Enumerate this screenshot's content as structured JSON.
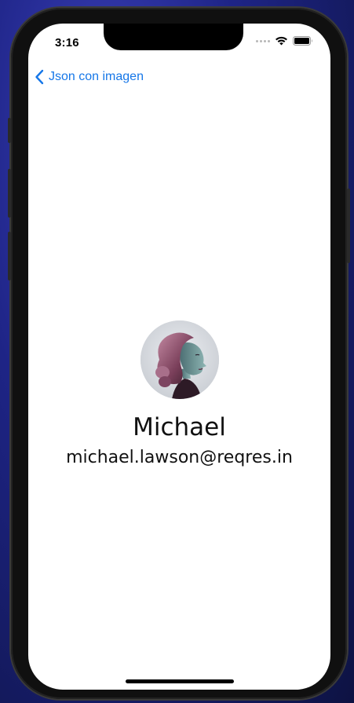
{
  "status_bar": {
    "time": "3:16"
  },
  "navigation": {
    "back_label": "Json con imagen"
  },
  "profile": {
    "name": "Michael",
    "email": "michael.lawson@reqres.in"
  },
  "icons": [
    "chevron-left-icon",
    "wifi-icon",
    "battery-icon",
    "cellular-icon"
  ],
  "colors": {
    "accent": "#1677e8",
    "text": "#111111",
    "background": "#ffffff"
  }
}
